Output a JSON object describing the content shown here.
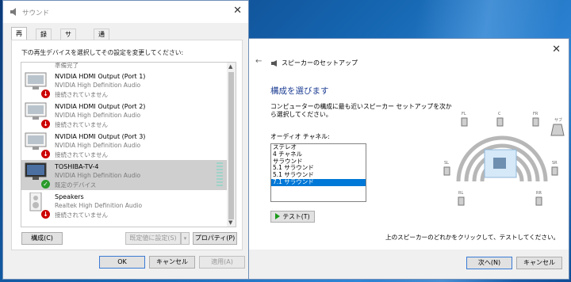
{
  "sound_dialog": {
    "title": "サウンド",
    "tabs": [
      "再生",
      "録音",
      "サウンド",
      "通信"
    ],
    "instruction": "下の再生デバイスを選択してその設定を変更してください:",
    "partial_top": "準備完了",
    "devices": [
      {
        "name": "NVIDIA HDMI Output (Port 1)",
        "driver": "NVIDIA High Definition Audio",
        "status": "接続されていません",
        "state": "disconnected"
      },
      {
        "name": "NVIDIA HDMI Output (Port 2)",
        "driver": "NVIDIA High Definition Audio",
        "status": "接続されていません",
        "state": "disconnected"
      },
      {
        "name": "NVIDIA HDMI Output (Port 3)",
        "driver": "NVIDIA High Definition Audio",
        "status": "接続されていません",
        "state": "disconnected"
      },
      {
        "name": "TOSHIBA-TV-4",
        "driver": "NVIDIA High Definition Audio",
        "status": "既定のデバイス",
        "state": "default"
      },
      {
        "name": "Speakers",
        "driver": "Realtek High Definition Audio",
        "status": "接続されていません",
        "state": "disconnected"
      }
    ],
    "buttons": {
      "configure": "構成(C)",
      "set_default": "既定値に設定(S)",
      "properties": "プロパティ(P)",
      "ok": "OK",
      "cancel": "キャンセル",
      "apply": "適用(A)"
    },
    "colors": {
      "selected_row": "#cfcfcf",
      "default_check": "#2a9a2a",
      "disconnected_badge": "#cc0000"
    }
  },
  "speaker_setup": {
    "window_title": "スピーカーのセットアップ",
    "heading": "構成を選びます",
    "description": "コンピューターの構成に最も近いスピーカー セットアップを次から選択してください。",
    "channel_label": "オーディオ チャネル:",
    "channels": [
      "ステレオ",
      "4 チャネル",
      "サラウンド",
      "5.1 サラウンド",
      "5.1 サラウンド",
      "7.1 サラウンド"
    ],
    "selected_channel_index": 5,
    "test_button": "テスト(T)",
    "footer_hint": "上のスピーカーのどれかをクリックして、テストしてください。",
    "buttons": {
      "next": "次へ(N)",
      "cancel": "キャンセル"
    },
    "speaker_labels": [
      "FL",
      "C",
      "FR",
      "サブ",
      "SL",
      "SR",
      "RL",
      "RR"
    ],
    "colors": {
      "heading": "#1f3f94",
      "selection": "#0078d7"
    }
  }
}
